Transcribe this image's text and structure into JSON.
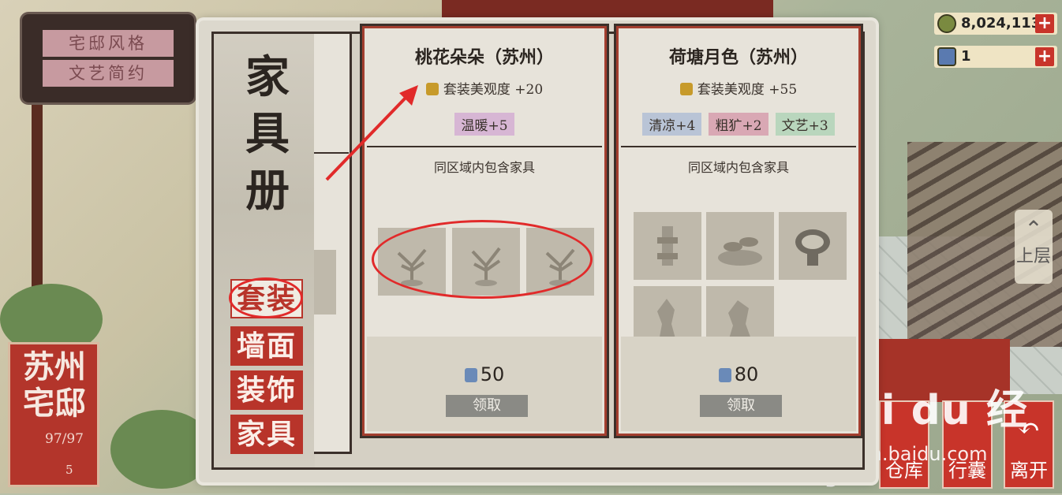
{
  "style_sign": {
    "line1": "宅邸风格",
    "line2": "文艺简约"
  },
  "location": {
    "name": "苏州宅邸",
    "count": "97/97",
    "small": "5"
  },
  "currency": {
    "coins": "8,024,113",
    "tickets": "1",
    "plus": "+"
  },
  "side_button": {
    "label": "上层"
  },
  "bottom_buttons": [
    {
      "label": "仓库"
    },
    {
      "label": "行囊"
    },
    {
      "label": "离开"
    }
  ],
  "watermark": {
    "brand": "Bai du 经验",
    "url": "jingyan.baidu.com"
  },
  "book": {
    "title": "家具册",
    "categories": [
      "套装",
      "墙面",
      "装饰",
      "家具"
    ],
    "active_category": "套装"
  },
  "cards": [
    {
      "name": "桃花朵朵（苏州）",
      "beauty": "套装美观度 +20",
      "tags": [
        {
          "label": "温暖+5",
          "color": "#d7b6d4"
        }
      ],
      "sub": "同区域内包含家具",
      "price": "50",
      "claim": "领取"
    },
    {
      "name": "荷塘月色（苏州）",
      "beauty": "套装美观度 +55",
      "tags": [
        {
          "label": "清凉+4",
          "color": "#b9c4d6"
        },
        {
          "label": "粗犷+2",
          "color": "#d9a8b4"
        },
        {
          "label": "文艺+3",
          "color": "#b9d6bd"
        }
      ],
      "sub": "同区域内包含家具",
      "price": "80",
      "claim": "领取"
    }
  ],
  "colors": {
    "accent_red": "#b8342a",
    "annotation": "#e12a2a"
  }
}
